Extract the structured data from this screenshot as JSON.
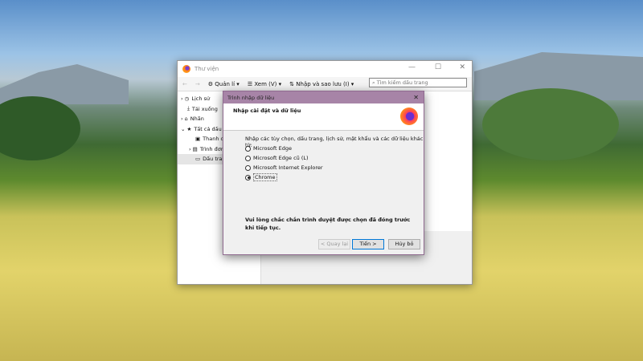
{
  "library": {
    "title": "Thư viện",
    "toolbar": {
      "organize": "Quản lí",
      "view": "Xem (V)",
      "import_backup": "Nhập và sao lưu (I)"
    },
    "search_placeholder": "Tìm kiếm dấu trang",
    "sidebar": [
      "Lịch sử",
      "Tải xuống",
      "Nhãn",
      "Tất cả dấu trang",
      "Thanh dấu trang",
      "Trình đơn dấu trang",
      "Dấu trang khác"
    ]
  },
  "dialog": {
    "title": "Trình nhập dữ liệu",
    "heading": "Nhập cài đặt và dữ liệu",
    "intro": "Nhập các tùy chọn, dấu trang, lịch sử, mật khẩu và các dữ liệu khác từ:",
    "options": [
      {
        "label": "Microsoft Edge",
        "selected": false
      },
      {
        "label": "Microsoft Edge cũ (L)",
        "selected": false
      },
      {
        "label": "Microsoft Internet Explorer",
        "selected": false
      },
      {
        "label": "Chrome",
        "selected": true
      }
    ],
    "warning": "Vui lòng chắc chắn trình duyệt được chọn đã đóng trước khi tiếp tục.",
    "back": "< Quay lại",
    "next": "Tiến >",
    "cancel": "Hủy bỏ"
  }
}
